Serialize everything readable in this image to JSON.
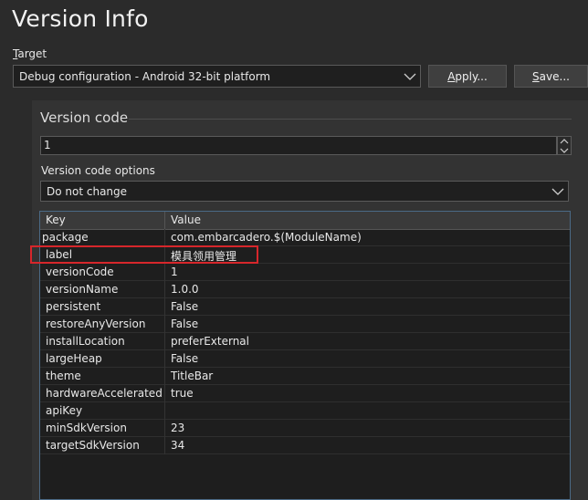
{
  "page": {
    "title": "Version Info"
  },
  "target": {
    "label_mnemonic": "T",
    "label_rest": "arget",
    "selected": "Debug configuration - Android 32-bit platform",
    "apply_mnemonic": "A",
    "apply_rest": "pply...",
    "save_mnemonic": "S",
    "save_rest": "ave..."
  },
  "version_code": {
    "section_title": "Version code",
    "value": "1",
    "options_label": "Version code options",
    "options_selected": "Do not change"
  },
  "grid": {
    "header_key": "Key",
    "header_value": "Value",
    "rows": [
      {
        "key": "package",
        "value": "com.embarcadero.$(ModuleName)"
      },
      {
        "key": "label",
        "value": "模具领用管理"
      },
      {
        "key": "versionCode",
        "value": "1"
      },
      {
        "key": "versionName",
        "value": "1.0.0"
      },
      {
        "key": "persistent",
        "value": "False"
      },
      {
        "key": "restoreAnyVersion",
        "value": "False"
      },
      {
        "key": "installLocation",
        "value": "preferExternal"
      },
      {
        "key": "largeHeap",
        "value": "False"
      },
      {
        "key": "theme",
        "value": "TitleBar"
      },
      {
        "key": "hardwareAccelerated",
        "value": "true"
      },
      {
        "key": "apiKey",
        "value": ""
      },
      {
        "key": "minSdkVersion",
        "value": "23"
      },
      {
        "key": "targetSdkVersion",
        "value": "34"
      }
    ]
  },
  "icons": {
    "dropdown": "chevron-down-icon",
    "spin_up": "chevron-up-icon",
    "spin_down": "chevron-down-icon"
  },
  "colors": {
    "background": "#2b2b2b",
    "panel": "#333333",
    "grid_border": "#4b6a86",
    "highlight": "#d7262b"
  }
}
